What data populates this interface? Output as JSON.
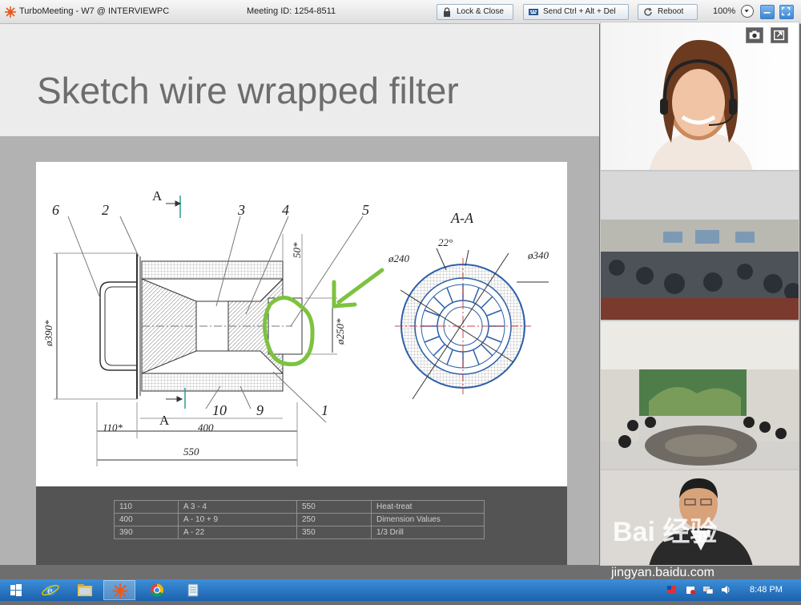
{
  "titlebar": {
    "app_title": "TurboMeeting - W7 @ INTERVIEWPC",
    "meeting_id": "Meeting ID: 1254-8511",
    "lock_close": "Lock & Close",
    "send_cad": "Send Ctrl + Alt + Del",
    "reboot": "Reboot",
    "zoom": "100%"
  },
  "slide": {
    "title": "Sketch wire wrapped filter",
    "drawing": {
      "section_marker": "A",
      "section_title": "A-A",
      "callouts": [
        "6",
        "2",
        "3",
        "4",
        "5",
        "10",
        "9",
        "1"
      ],
      "dims": {
        "d390": "ø390*",
        "d250": "ø250*",
        "d240": "ø240",
        "d340": "ø340",
        "angle": "22°",
        "fifty": "50*",
        "l110": "110*",
        "l400": "400",
        "l550": "550"
      }
    },
    "table": {
      "rows": [
        [
          "110",
          "A 3 - 4",
          "550",
          "Heat-treat"
        ],
        [
          "400",
          "A - 10 + 9",
          "250",
          "Dimension Values"
        ],
        [
          "390",
          "A - 22",
          "350",
          "1/3 Drill"
        ]
      ]
    }
  },
  "watermark": {
    "brand": "Bai 经验",
    "url": "jingyan.baidu.com"
  },
  "taskbar": {
    "clock": "8:48 PM"
  },
  "colors": {
    "annotation_green": "#7dc241",
    "drawing_blue": "#2c5fa8",
    "taskbar_blue": "#1b62ad"
  },
  "icons": [
    "turbomeeting-logo-icon",
    "lock-icon",
    "keyboard-icon",
    "reboot-icon",
    "chevron-down-icon",
    "minimize-icon",
    "fullscreen-icon",
    "camera-icon",
    "popout-icon",
    "windows-start-icon",
    "ie-icon",
    "folder-icon",
    "turbomeeting-icon",
    "chrome-icon",
    "notepad-icon"
  ]
}
